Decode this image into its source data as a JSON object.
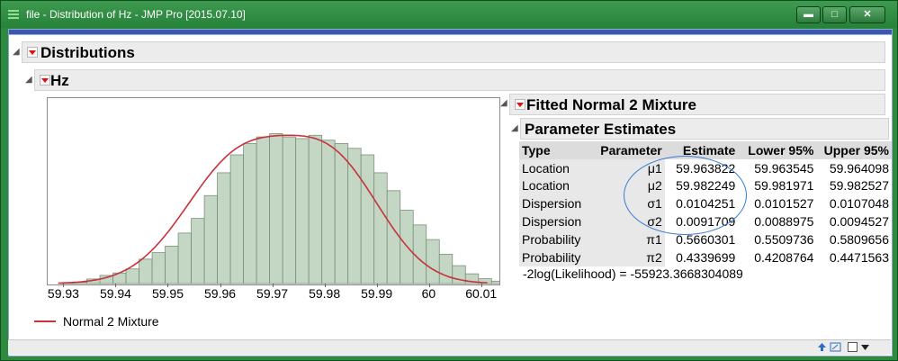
{
  "window": {
    "title": "file - Distribution of Hz - JMP Pro [2015.07.10]",
    "buttons": {
      "minimize": "▬",
      "maximize": "□",
      "close": "✕"
    }
  },
  "report": {
    "distributions_label": "Distributions",
    "hz_label": "Hz",
    "fitted_label": "Fitted Normal 2 Mixture",
    "param_label": "Parameter Estimates",
    "legend_label": "Normal 2 Mixture",
    "loglik_text": "-2log(Likelihood) = -55923.3668304089"
  },
  "params_table": {
    "headers": [
      "Type",
      "Parameter",
      "Estimate",
      "Lower 95%",
      "Upper 95%"
    ],
    "rows": [
      [
        "Location",
        "μ1",
        "59.963822",
        "59.963545",
        "59.964098"
      ],
      [
        "Location",
        "μ2",
        "59.982249",
        "59.981971",
        "59.982527"
      ],
      [
        "Dispersion",
        "σ1",
        "0.0104251",
        "0.0101527",
        "0.0107048"
      ],
      [
        "Dispersion",
        "σ2",
        "0.0091709",
        "0.0088975",
        "0.0094527"
      ],
      [
        "Probability",
        "π1",
        "0.5660301",
        "0.5509736",
        "0.5809656"
      ],
      [
        "Probability",
        "π2",
        "0.4339699",
        "0.4208764",
        "0.4471563"
      ]
    ]
  },
  "chart_data": {
    "type": "bar",
    "x_ticks": [
      "59.93",
      "59.94",
      "59.95",
      "59.96",
      "59.97",
      "59.98",
      "59.99",
      "60",
      "60.01"
    ],
    "xlim": [
      59.927,
      60.0135
    ],
    "bin_width": 0.0025,
    "bin_start": 59.9295,
    "values": [
      0.3,
      0.8,
      2.8,
      5,
      6.5,
      9,
      15,
      19,
      23,
      31,
      40,
      54,
      68,
      79,
      86,
      90,
      92,
      90,
      89,
      91,
      88,
      86,
      83,
      79,
      68,
      57,
      45,
      36,
      27,
      18,
      11,
      6,
      3,
      1.5,
      0.8
    ],
    "ylim": [
      0,
      100
    ],
    "series": [
      {
        "name": "Normal 2 Mixture",
        "color": "#c8323a",
        "mu": [
          59.963822,
          59.982249
        ],
        "sigma": [
          0.0104251,
          0.0091709
        ],
        "pi": [
          0.5660301,
          0.4339699
        ]
      }
    ],
    "bar_color": "#c4d7c5",
    "bar_edge": "#7a8f7b",
    "legend_position": "bottom-left"
  },
  "status": {
    "icons": [
      "arrow-up-icon",
      "link-icon",
      "checkbox-icon",
      "dropdown-icon"
    ]
  }
}
